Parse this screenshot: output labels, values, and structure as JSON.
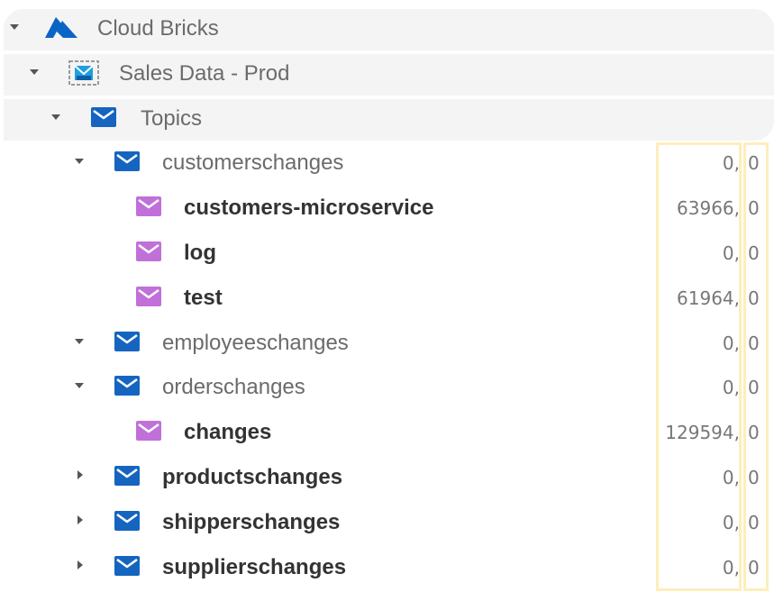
{
  "colors": {
    "azure_blue": "#0a64c6",
    "topic_blue": "#1565c0",
    "subscription_purple": "#c070d8",
    "column_highlight": "#fdeebb",
    "selected_row_bg": "#f4f4f4"
  },
  "tree": [
    {
      "label": "Cloud Bricks",
      "icon": "azure-icon",
      "expanded": true,
      "level": 0,
      "bold": false
    },
    {
      "label": "Sales Data - Prod",
      "icon": "namespace-icon",
      "expanded": true,
      "level": 1,
      "bold": false
    },
    {
      "label": "Topics",
      "icon": "mail-icon",
      "expanded": true,
      "level": 2,
      "bold": false
    },
    {
      "label": "customerschanges",
      "icon": "mail-icon",
      "expanded": true,
      "level": 3,
      "bold": false,
      "count1": "0,",
      "count2": "0"
    },
    {
      "label": "customers-microservice",
      "icon": "mail-open-icon",
      "level": 4,
      "bold": true,
      "count1": "63966,",
      "count2": "0"
    },
    {
      "label": "log",
      "icon": "mail-open-icon",
      "level": 4,
      "bold": true,
      "count1": "0,",
      "count2": "0"
    },
    {
      "label": "test",
      "icon": "mail-open-icon",
      "level": 4,
      "bold": true,
      "count1": "61964,",
      "count2": "0"
    },
    {
      "label": "employeeschanges",
      "icon": "mail-icon",
      "expanded": true,
      "level": 3,
      "bold": false,
      "count1": "0,",
      "count2": "0"
    },
    {
      "label": "orderschanges",
      "icon": "mail-icon",
      "expanded": true,
      "level": 3,
      "bold": false,
      "count1": "0,",
      "count2": "0"
    },
    {
      "label": "changes",
      "icon": "mail-open-icon",
      "level": 4,
      "bold": true,
      "count1": "129594,",
      "count2": "0"
    },
    {
      "label": "productschanges",
      "icon": "mail-icon",
      "expanded": false,
      "level": 3,
      "bold": true,
      "count1": "0,",
      "count2": "0"
    },
    {
      "label": "shipperschanges",
      "icon": "mail-icon",
      "expanded": false,
      "level": 3,
      "bold": true,
      "count1": "0,",
      "count2": "0"
    },
    {
      "label": "supplierschanges",
      "icon": "mail-icon",
      "expanded": false,
      "level": 3,
      "bold": true,
      "count1": "0,",
      "count2": "0"
    }
  ]
}
